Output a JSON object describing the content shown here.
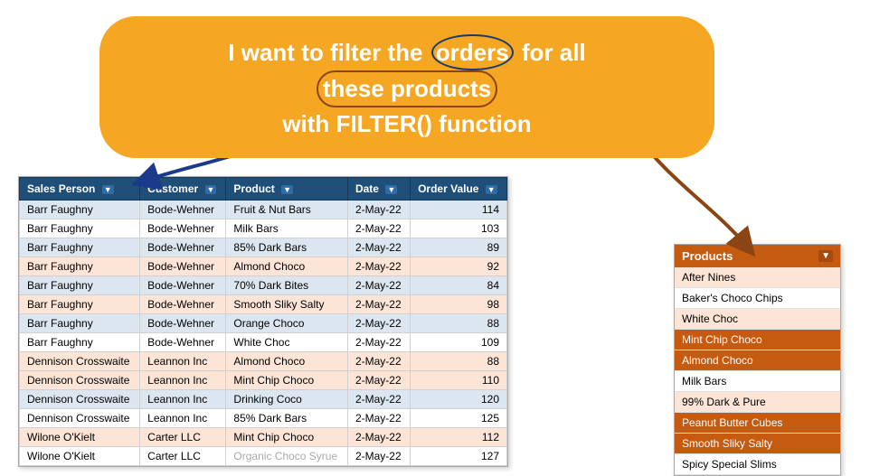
{
  "bubble": {
    "line1": "I want to filter the ",
    "orders": "orders",
    "line1b": " for all ",
    "these_products": "these products",
    "line2": "with FILTER() function"
  },
  "table": {
    "headers": [
      "Sales Person",
      "Customer",
      "Product",
      "Date",
      "Order Value"
    ],
    "rows": [
      [
        "Barr Faughny",
        "Bode-Wehner",
        "Fruit & Nut Bars",
        "2-May-22",
        "114"
      ],
      [
        "Barr Faughny",
        "Bode-Wehner",
        "Milk Bars",
        "2-May-22",
        "103"
      ],
      [
        "Barr Faughny",
        "Bode-Wehner",
        "85% Dark Bars",
        "2-May-22",
        "89"
      ],
      [
        "Barr Faughny",
        "Bode-Wehner",
        "Almond Choco",
        "2-May-22",
        "92"
      ],
      [
        "Barr Faughny",
        "Bode-Wehner",
        "70% Dark Bites",
        "2-May-22",
        "84"
      ],
      [
        "Barr Faughny",
        "Bode-Wehner",
        "Smooth Sliky Salty",
        "2-May-22",
        "98"
      ],
      [
        "Barr Faughny",
        "Bode-Wehner",
        "Orange Choco",
        "2-May-22",
        "88"
      ],
      [
        "Barr Faughny",
        "Bode-Wehner",
        "White Choc",
        "2-May-22",
        "109"
      ],
      [
        "Dennison Crosswaite",
        "Leannon Inc",
        "Almond Choco",
        "2-May-22",
        "88"
      ],
      [
        "Dennison Crosswaite",
        "Leannon Inc",
        "Mint Chip Choco",
        "2-May-22",
        "110"
      ],
      [
        "Dennison Crosswaite",
        "Leannon Inc",
        "Drinking Coco",
        "2-May-22",
        "120"
      ],
      [
        "Dennison Crosswaite",
        "Leannon Inc",
        "85% Dark Bars",
        "2-May-22",
        "125"
      ],
      [
        "Wilone O'Kielt",
        "Carter LLC",
        "Mint Chip Choco",
        "2-May-22",
        "112"
      ],
      [
        "Wilone O'Kielt",
        "Carter LLC",
        "Organic Choco Syrue",
        "2-May-22",
        "127"
      ]
    ]
  },
  "products": {
    "header": "Products",
    "items": [
      "After Nines",
      "Baker's Choco Chips",
      "White Choc",
      "Mint Chip Choco",
      "Almond Choco",
      "Milk Bars",
      "99% Dark & Pure",
      "Peanut Butter Cubes",
      "Smooth Sliky Salty",
      "Spicy Special Slims"
    ],
    "highlighted": [
      "Chip Choco",
      "Almond Choco",
      "Peanut Butter Cubes"
    ]
  },
  "arrows": {
    "blue_label": "arrow from bubble to table",
    "orange_label": "arrow from bubble to products"
  }
}
